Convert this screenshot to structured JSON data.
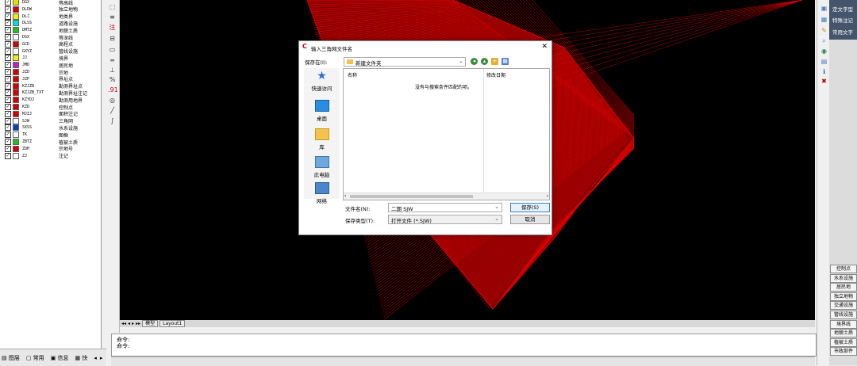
{
  "layers": [
    {
      "code": "DGX",
      "name": "等高线",
      "color": "#e0e000"
    },
    {
      "code": "DLDW",
      "name": "独立地物",
      "color": "#d00000"
    },
    {
      "code": "DLJ",
      "name": "地类界",
      "color": "#f0f000"
    },
    {
      "code": "DLSS",
      "name": "道路设施",
      "color": "#00e0e0"
    },
    {
      "code": "DMTZ",
      "name": "地貌土质",
      "color": "#20c020"
    },
    {
      "code": "DSX",
      "name": "等深线",
      "color": "#ffffff"
    },
    {
      "code": "GCD",
      "name": "高程点",
      "color": "#d00000"
    },
    {
      "code": "GXYZ",
      "name": "管线设施",
      "color": "#ffffff"
    },
    {
      "code": "JJ",
      "name": "境界",
      "color": "#f0f000"
    },
    {
      "code": "JMD",
      "name": "居民地",
      "color": "#c020c0"
    },
    {
      "code": "JZD",
      "name": "宗地",
      "color": "#d00000"
    },
    {
      "code": "JZP",
      "name": "界址点",
      "color": "#d00000"
    },
    {
      "code": "KZJZB",
      "name": "勘测界址点",
      "color": "#d00000"
    },
    {
      "code": "KZJZB_TXT",
      "name": "勘测界址注记",
      "color": "#d00000"
    },
    {
      "code": "KZYDJ",
      "name": "勘测用地界",
      "color": "#d00000"
    },
    {
      "code": "KZD",
      "name": "控制点",
      "color": "#d00000"
    },
    {
      "code": "MJZJ",
      "name": "面积注记",
      "color": "#d00000"
    },
    {
      "code": "SJW",
      "name": "三角网",
      "color": "#ffffff"
    },
    {
      "code": "SXSS",
      "name": "水系设施",
      "color": "#0040d0"
    },
    {
      "code": "TK",
      "name": "图框",
      "color": "#ffffff"
    },
    {
      "code": "ZBTZ",
      "name": "植被土质",
      "color": "#20c020"
    },
    {
      "code": "ZDH",
      "name": "宗地号",
      "color": "#d00000"
    },
    {
      "code": "ZJ",
      "name": "注记",
      "color": "#ffffff"
    }
  ],
  "layer_tabs": {
    "layer": "图层",
    "common": "常用",
    "info": "信息",
    "cut": "快"
  },
  "layout_tabs": {
    "model": "模型",
    "layout1": "Layout1"
  },
  "command_lines": [
    "命令:",
    "命令:"
  ],
  "right_top_menu": [
    "定文字型",
    "特殊注记",
    "常用文字"
  ],
  "right_buttons": [
    "控制点",
    "水系设施",
    "居民地",
    "独立地物",
    "交通设施",
    "管线设施",
    "境界线",
    "地貌土质",
    "植被土质",
    "市政部件"
  ],
  "dialog": {
    "title": "输入三角网文件名",
    "save_in_label": "保存在(I):",
    "save_in_value": "新建文件夹",
    "places": [
      "快速访问",
      "桌面",
      "库",
      "此电脑",
      "网络"
    ],
    "col_name": "名称",
    "col_modified": "修改日期",
    "empty_message": "没有与搜索条件匹配的项。",
    "filename_label": "文件名(N):",
    "filename_value": "二期 SJW",
    "filetype_label": "保存类型(T):",
    "filetype_value": "打开文件 (*.SJW)",
    "save_button": "保存(S)",
    "cancel_button": "取消"
  },
  "colors": {
    "canvas": "#000000",
    "mesh": "#e00000",
    "dialog_accent": "#3c7fd1"
  }
}
